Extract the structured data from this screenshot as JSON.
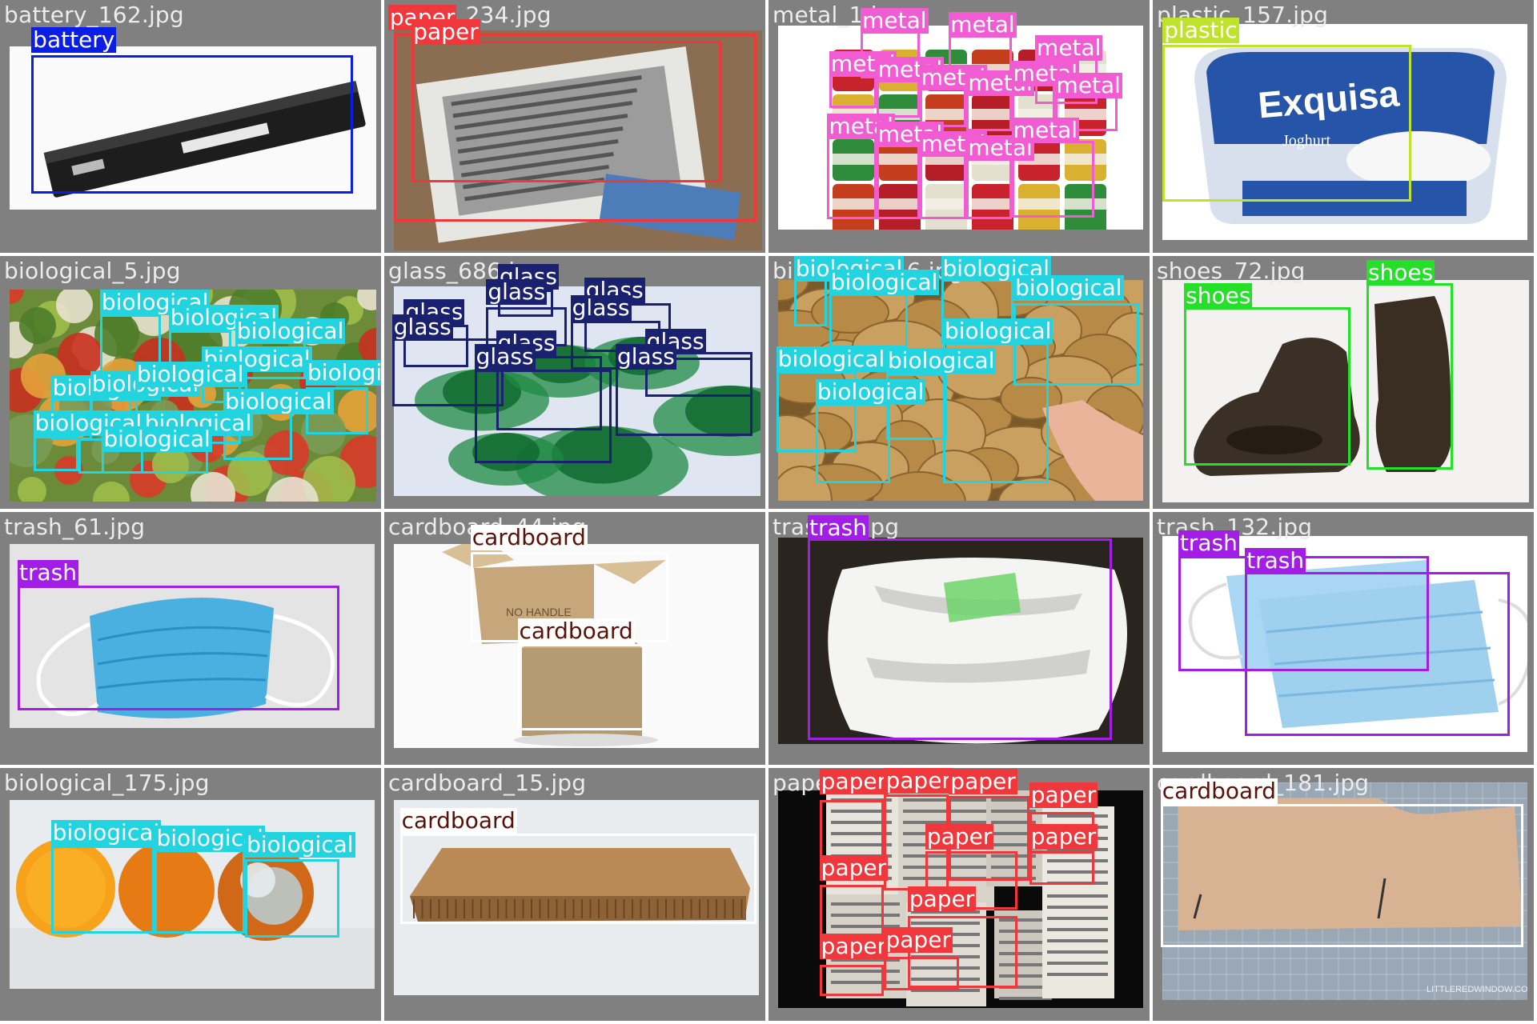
{
  "colors": {
    "battery": "#0A1EE8",
    "paper": "#F0373C",
    "metal": "#F25CD2",
    "plastic": "#BFE22A",
    "biological": "#22D3E0",
    "glass": "#1A2270",
    "shoes": "#24E028",
    "trash": "#A21EE6",
    "cardboard": "#FFFFFF",
    "cardboard_text": "#5A1208"
  },
  "cells": [
    {
      "title": "battery_162.jpg",
      "labels": [
        "battery"
      ]
    },
    {
      "title": "paper_234.jpg",
      "labels": [
        "paper",
        "paper"
      ]
    },
    {
      "title": "metal_1.jpg",
      "labels": [
        "metal",
        "metal",
        "metal",
        "metal",
        "metal",
        "metal",
        "metal",
        "metal",
        "metal",
        "metal",
        "metal",
        "metal",
        "metal",
        "metal"
      ]
    },
    {
      "title": "plastic_157.jpg",
      "labels": [
        "plastic"
      ]
    },
    {
      "title": "biological_5.jpg",
      "labels": [
        "biological",
        "biological",
        "biological",
        "biological",
        "biological",
        "biological",
        "biological",
        "biological",
        "biological",
        "biological",
        "biological",
        "biological"
      ]
    },
    {
      "title": "glass_686.jpg",
      "labels": [
        "glass",
        "glass",
        "glass",
        "glass",
        "glass",
        "glass",
        "glass",
        "glass",
        "glass",
        "glass"
      ]
    },
    {
      "title": "biological_16.jpg",
      "labels": [
        "biological",
        "biological",
        "biological",
        "biological",
        "biological",
        "biological",
        "biological",
        "biological"
      ]
    },
    {
      "title": "shoes_72.jpg",
      "labels": [
        "shoes",
        "shoes"
      ]
    },
    {
      "title": "trash_61.jpg",
      "labels": [
        "trash"
      ]
    },
    {
      "title": "cardboard_44.jpg",
      "labels": [
        "cardboard",
        "cardboard"
      ]
    },
    {
      "title": "trash_8.jpg",
      "labels": [
        "trash"
      ]
    },
    {
      "title": "trash_132.jpg",
      "labels": [
        "trash",
        "trash"
      ]
    },
    {
      "title": "biological_175.jpg",
      "labels": [
        "biological",
        "biological",
        "biological"
      ]
    },
    {
      "title": "cardboard_15.jpg",
      "labels": [
        "cardboard"
      ]
    },
    {
      "title": "paper_12.jpg",
      "labels": [
        "paper",
        "paper",
        "paper",
        "paper",
        "paper",
        "paper",
        "paper",
        "paper",
        "paper",
        "paper"
      ]
    },
    {
      "title": "cardboard_181.jpg",
      "labels": [
        "cardboard"
      ]
    }
  ],
  "photo_text": {
    "plastic_brand": "Exquisa",
    "plastic_sub": "Joghurt",
    "box_text": "NO HANDLE",
    "watermark": "LITTLEREDWINDOW.COM"
  }
}
